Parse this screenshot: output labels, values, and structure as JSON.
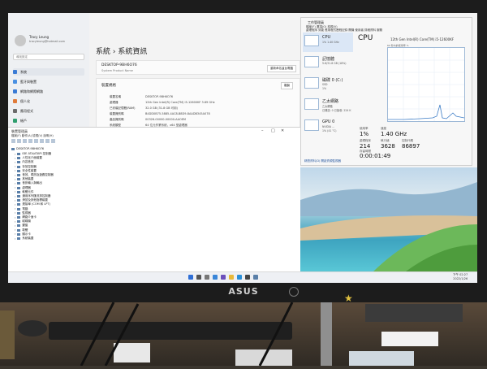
{
  "monitor": {
    "brand": "ASUS"
  },
  "settings": {
    "user_name": "Tracy Leung",
    "user_email": "tracyleung@hotmail.com",
    "search_placeholder": "尋找設定",
    "nav": [
      {
        "label": "系統",
        "color": "#3a7bd5"
      },
      {
        "label": "藍牙與裝置",
        "color": "#4a90e2"
      },
      {
        "label": "網路和網際網路",
        "color": "#3a7bd5"
      },
      {
        "label": "個人化",
        "color": "#e07b39"
      },
      {
        "label": "應用程式",
        "color": "#6b6b6b"
      },
      {
        "label": "帳戶",
        "color": "#2f9e6e"
      }
    ],
    "page_title": "系統 › 系統資訊",
    "device_name": "DESKTOP-9BH6O76",
    "device_sub": "System Product Name",
    "rename_label": "重新命名這台電腦",
    "spec_title": "裝置規格",
    "copy_label": "複製",
    "specs": [
      {
        "k": "裝置名稱",
        "v": "DESKTOP-9BH6O76"
      },
      {
        "k": "處理器",
        "v": "12th Gen Intel(R) Core(TM) i5-12600KF   3.69 GHz"
      },
      {
        "k": "已安裝記憶體(RAM)",
        "v": "32.0 GB (31.8 GB 可用)"
      },
      {
        "k": "裝置識別碼",
        "v": "B4DD0B75-5885-4AC8-B8D9-8AADB345A078"
      },
      {
        "k": "產品識別碼",
        "v": "00326-00000-00000-AAOEM"
      },
      {
        "k": "系統類型",
        "v": "64 位元作業系統，x64 型處理器"
      },
      {
        "k": "手寫筆與觸控",
        "v": "此顯示器不提供手寫筆或觸控式輸入功能"
      }
    ]
  },
  "devmgr": {
    "title": "裝置管理員",
    "menu": "檔案(F)  動作(A)  檢視(V)  說明(H)",
    "root": "DESKTOP-9BH6O76",
    "items": [
      "IDE ATA/ATAPI 控制器",
      "人性化介面裝置",
      "內容音效",
      "存放控制器",
      "安全性裝置",
      "音效、視訊及遊戲控制器",
      "其他裝置",
      "音訊輸入與輸出",
      "處理器",
      "軟體元件",
      "通用序列匯流排控制器",
      "滑鼠及其他指標裝置",
      "連接埠 (COM 和 LPT)",
      "電腦",
      "監視器",
      "網路介面卡",
      "磁碟機",
      "鍵盤",
      "韌體",
      "顯示卡",
      "系統裝置"
    ]
  },
  "taskmgr": {
    "title": "工作管理員",
    "menu": "檔案(F)  選項(O)  檢視(V)",
    "tabs_line": "處理程序  效能  應用程式歷程記錄  開機  使用者  詳細資料  服務",
    "side": [
      {
        "name": "CPU",
        "sub": "1%  1.40 GHz",
        "sub2": ""
      },
      {
        "name": "記憶體",
        "sub": "5.6/31.8 GB (18%)",
        "sub2": ""
      },
      {
        "name": "磁碟 0 (C:)",
        "sub": "SSD",
        "sub2": "1%"
      },
      {
        "name": "乙太網路",
        "sub": "乙太網路",
        "sub2": "已傳送: 0  已接收: 224 K"
      },
      {
        "name": "GPU 0",
        "sub": "NVIDIA ...",
        "sub2": "1% (41 °C)"
      }
    ],
    "cpu_heading": "CPU",
    "cpu_model": "12th Gen Intel(R) Core(TM) i5-12600KF",
    "util_label": "60 秒內的使用率 %",
    "stats": [
      {
        "label": "使用率",
        "value": "1%"
      },
      {
        "label": "速度",
        "value": "1.40 GHz"
      },
      {
        "label": "處理程序",
        "value": "214"
      },
      {
        "label": "執行緒",
        "value": "3628"
      },
      {
        "label": "控制代碼",
        "value": "86897"
      },
      {
        "label": "存留時間",
        "value": "0:00:01:49"
      }
    ],
    "footer": "精簡資料(D)   開啟資源監視器"
  },
  "taskbar": {
    "time": "下午 02:27",
    "date": "2022/1/26"
  }
}
